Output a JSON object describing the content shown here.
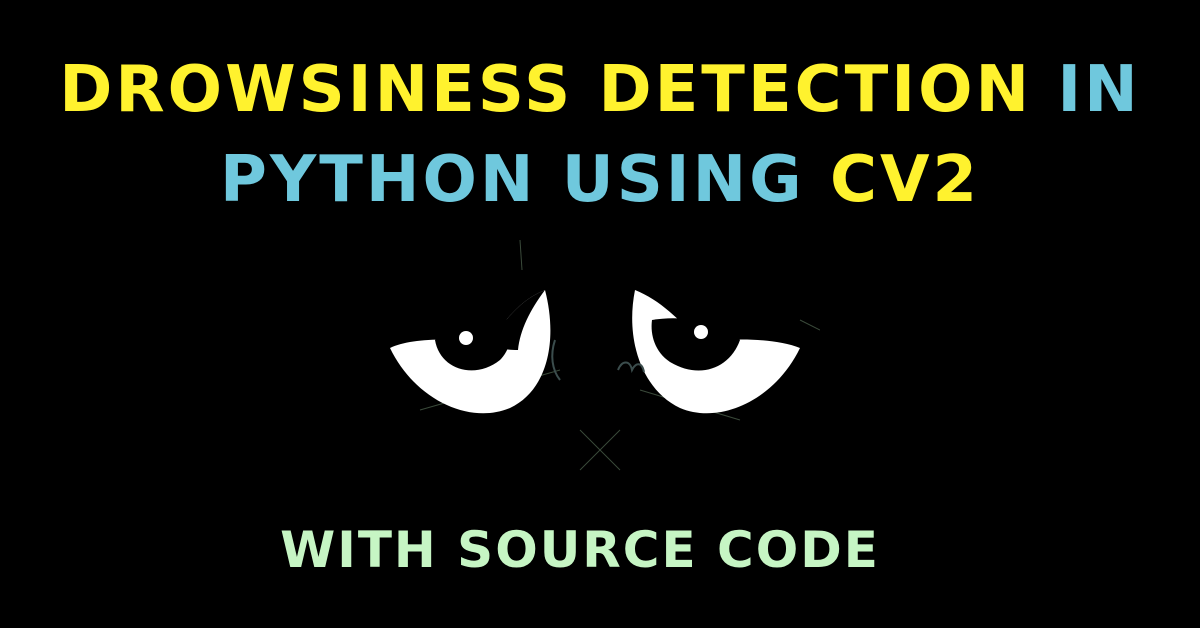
{
  "headline": {
    "line1_part1": "DROWSINESS DETECTION",
    "line1_part2": "IN",
    "line2_part1": "PYTHON USING",
    "line2_part2": "CV2"
  },
  "subheadline": "WITH SOURCE CODE",
  "illustration": {
    "icon": "sleepy-eyes-icon"
  },
  "colors": {
    "background": "#000000",
    "yellow": "#FFF22E",
    "blue": "#6FC8DD",
    "mint": "#C6F5C4",
    "eye_white": "#FFFFFF"
  }
}
